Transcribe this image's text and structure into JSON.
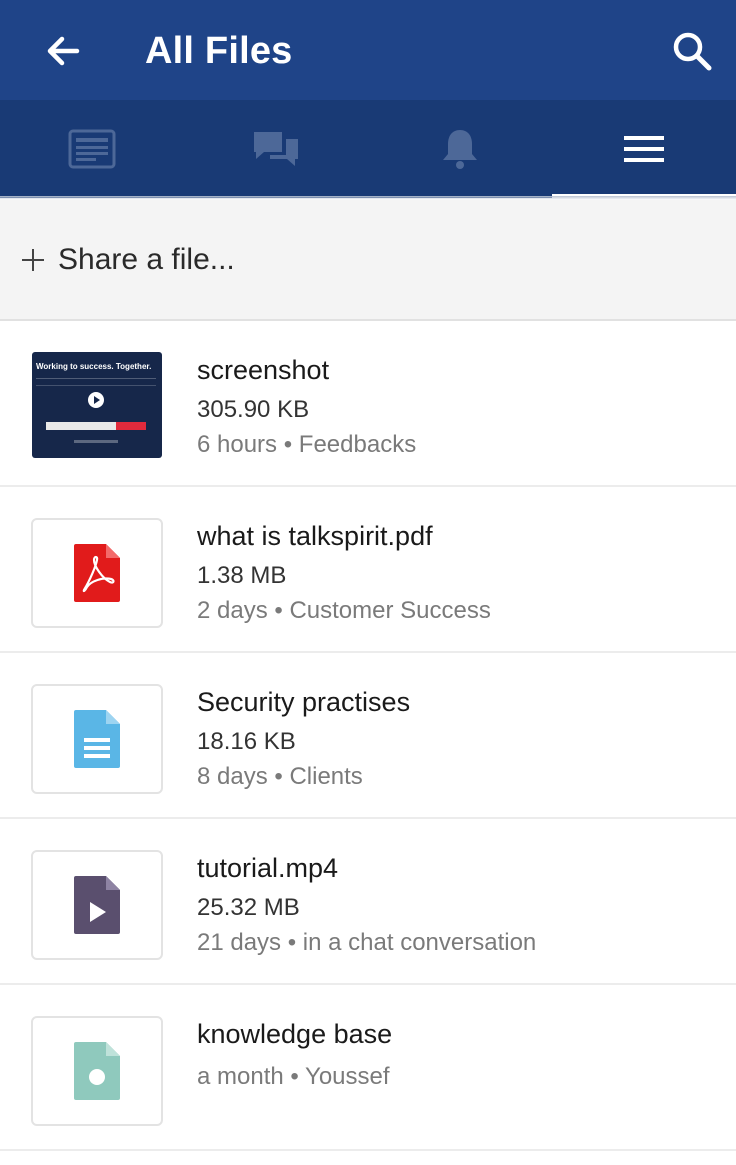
{
  "header": {
    "title": "All Files",
    "back_icon": "arrow-left-icon",
    "search_icon": "search-icon"
  },
  "tabs": [
    {
      "icon": "news-feed-icon",
      "active": false
    },
    {
      "icon": "chat-bubbles-icon",
      "active": false
    },
    {
      "icon": "bell-icon",
      "active": false
    },
    {
      "icon": "hamburger-menu-icon",
      "active": true
    }
  ],
  "share": {
    "label": "Share a file..."
  },
  "files": [
    {
      "name": "screenshot",
      "size": "305.90 KB",
      "meta": "6 hours • Feedbacks",
      "type": "image",
      "thumb_title": "Working to success. Together."
    },
    {
      "name": "what is talkspirit.pdf",
      "size": "1.38 MB",
      "meta": "2 days • Customer Success",
      "type": "pdf",
      "icon_color": "#e11b1b"
    },
    {
      "name": "Security practises",
      "size": "18.16 KB",
      "meta": "8 days • Clients",
      "type": "document",
      "icon_color": "#5ab6e6"
    },
    {
      "name": "tutorial.mp4",
      "size": "25.32 MB",
      "meta": "21 days • in a chat conversation",
      "type": "video",
      "icon_color": "#5a4f6e"
    },
    {
      "name": "knowledge base",
      "size": "",
      "meta": "a month • Youssef",
      "type": "link",
      "icon_color": "#8fc9bd"
    }
  ],
  "colors": {
    "header_bg": "#1f4488",
    "tabbar_bg": "#193a75",
    "active_tab_indicator": "#ffffff"
  }
}
